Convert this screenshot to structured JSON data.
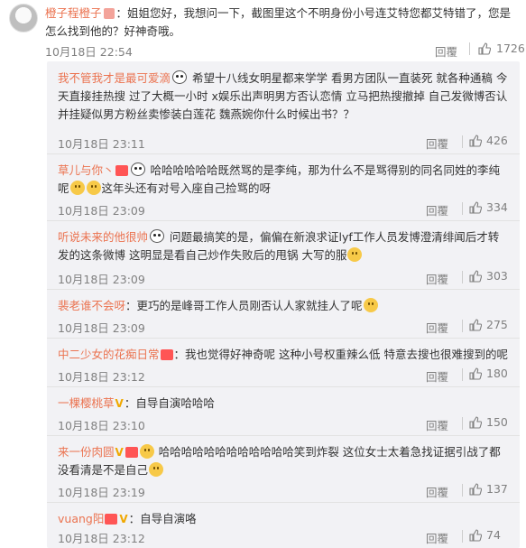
{
  "main_comment": {
    "username": "橙子程橙子",
    "text": "：姐姐您好，我想问一下，截图里这个不明身份小号连艾特您都艾特错了，您是怎么找到他的？好神奇哦。",
    "time": "10月18日 22:54",
    "reply_label": "回覆",
    "likes": "1726"
  },
  "replies": [
    {
      "username": "我不管我才是最可爱滴",
      "text": " 希望十八线女明星都来学学 看男方团队一直装死 就各种通稿 今天直接挂热搜 过了大概一小时 x娱乐出声明男方否认恋情 立马把热搜撤掉 自己发微博否认 并挂疑似男方粉丝卖惨装白莲花 魏燕婉你什么时候出书？？",
      "time": "10月18日 23:11",
      "reply_label": "回覆",
      "likes": "426"
    },
    {
      "username": "草儿与你丶",
      "text": " 哈哈哈哈哈哈既然骂的是李纯，那为什么不是骂得别的同名同姓的李纯呢",
      "text2": "这年头还有对号入座自己捡骂的呀",
      "time": "10月18日 23:09",
      "reply_label": "回覆",
      "likes": "334"
    },
    {
      "username": "听说未来的他很帅",
      "text": " 问题最搞笑的是，偏偏在新浪求证lyf工作人员发博澄清绯闻后才转发的这条微博 这明显是看自己炒作失败后的甩锅 大写的服",
      "time": "10月18日 23:09",
      "reply_label": "回覆",
      "likes": "303"
    },
    {
      "username": "裴老谁不会呀",
      "text": "：更巧的是峰哥工作人员刚否认人家就挂人了呢",
      "time": "10月18日 23:09",
      "reply_label": "回覆",
      "likes": "275"
    },
    {
      "username": "中二少女的花痴日常",
      "text": "：我也觉得好神奇呢 这种小号权重辣么低 特意去搜也很难搜到的呢",
      "time": "10月18日 23:12",
      "reply_label": "回覆",
      "likes": "180"
    },
    {
      "username": "一棵樱桃草",
      "text": "：自导自演哈哈哈",
      "time": "10月18日 23:10",
      "reply_label": "回覆",
      "likes": "150"
    },
    {
      "username": "来一份肉圆",
      "text": " 哈哈哈哈哈哈哈哈哈哈哈哈笑到炸裂 这位女士太着急找证据引战了都没看清是不是自己",
      "time": "10月18日 23:19",
      "reply_label": "回覆",
      "likes": "137"
    },
    {
      "username": "vuang阳",
      "text": "：自导自演咯",
      "time": "10月18日 23:12",
      "reply_label": "回覆",
      "likes": "74"
    }
  ],
  "colors": {
    "username": "#eb7350",
    "meta": "#808080",
    "reply_bg": "#f2f2f5"
  },
  "icons": {
    "like": "thumbs-up-icon",
    "emoji": "smile-emoji-icon",
    "vip": "vip-badge-icon"
  }
}
